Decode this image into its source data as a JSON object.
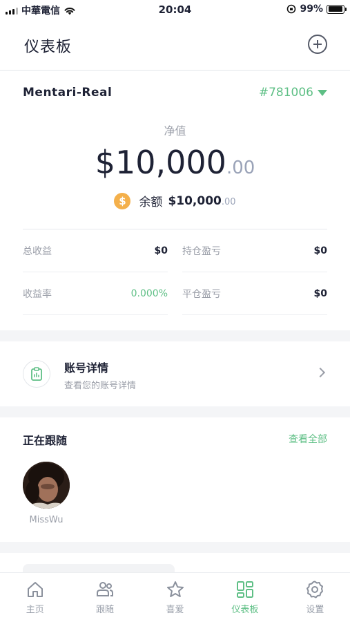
{
  "status_bar": {
    "carrier": "中華電信",
    "time": "20:04",
    "battery": "99%",
    "battery_level": 0.99
  },
  "header": {
    "title": "仪表板",
    "add_icon": "plus-circle-icon"
  },
  "account": {
    "name": "Mentari-Real",
    "id": "#781006",
    "equity_label": "净值",
    "equity_integer": "$10,000",
    "equity_decimal": ".00",
    "balance_label": "余额",
    "balance_integer": "$10,000",
    "balance_decimal": ".00",
    "stats": [
      {
        "label": "总收益",
        "value": "$0"
      },
      {
        "label": "持仓盈亏",
        "value": "$0"
      },
      {
        "label": "收益率",
        "value": "0.000%"
      },
      {
        "label": "平仓盈亏",
        "value": "$0"
      }
    ]
  },
  "details": {
    "title": "账号详情",
    "subtitle": "查看您的账号详情"
  },
  "following": {
    "title": "正在跟随",
    "view_all": "查看全部",
    "traders": [
      {
        "name": "MissWu"
      }
    ]
  },
  "tabs": [
    {
      "label": "主页",
      "icon": "home-icon",
      "active": false
    },
    {
      "label": "跟随",
      "icon": "users-icon",
      "active": false
    },
    {
      "label": "喜爱",
      "icon": "star-icon",
      "active": false
    },
    {
      "label": "仪表板",
      "icon": "dashboard-icon",
      "active": true
    },
    {
      "label": "设置",
      "icon": "gear-icon",
      "active": false
    }
  ],
  "colors": {
    "accent": "#5ebf85",
    "text_primary": "#1e2235",
    "text_secondary": "#9a9ea8",
    "coin": "#f4b04b"
  }
}
